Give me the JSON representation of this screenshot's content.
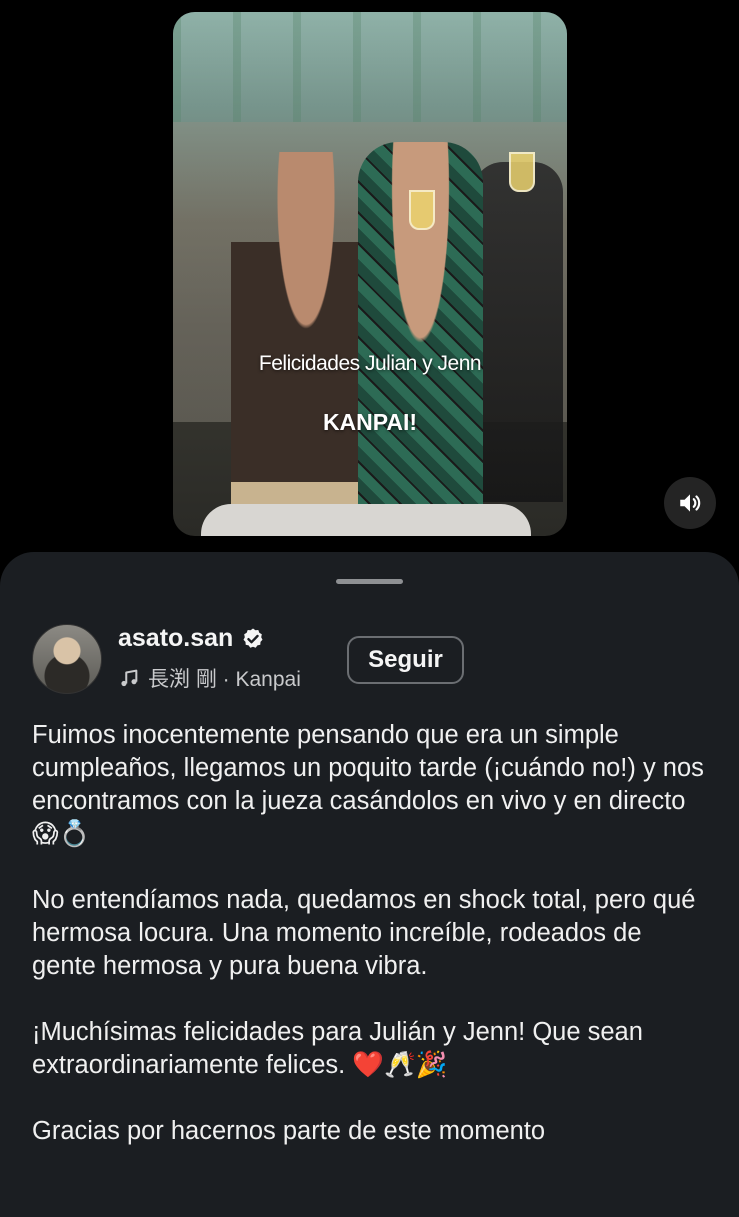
{
  "video": {
    "overlay_line1": "Felicidades Julian y Jenn",
    "overlay_line2": "KANPAI!",
    "sound_icon": "speaker-on-icon"
  },
  "post": {
    "username": "asato.san",
    "verified": true,
    "music_icon": "music-note-icon",
    "music_label": "長渕 剛 · Kanpai",
    "follow_label": "Seguir",
    "caption": [
      "Fuimos inocentemente pensando que era un simple cumpleaños, llegamos un poquito tarde (¡cuándo no!) y nos encontramos con la jueza casándolos en vivo y en directo 😱💍",
      "No entendíamos nada, quedamos en shock total, pero qué hermosa locura. Una momento increíble, rodeados de gente hermosa y pura buena vibra.",
      "¡Muchísimas felicidades para Julián y Jenn! Que sean extraordinariamente felices. ❤️🥂🎉",
      "Gracias por hacernos parte de este momento"
    ]
  },
  "colors": {
    "sheet_bg": "#1b1e22",
    "button_border": "#6b6e72"
  }
}
